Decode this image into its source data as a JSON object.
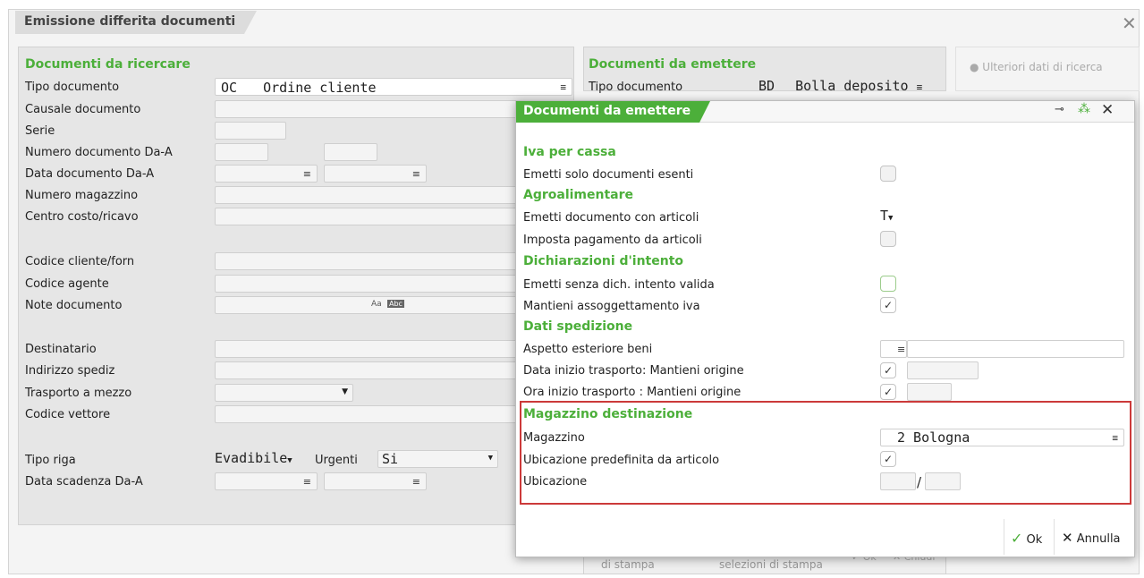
{
  "window": {
    "title": "Emissione differita documenti",
    "close_icon": "close-icon"
  },
  "left": {
    "section_title": "Documenti da ricercare",
    "tipo_documento": {
      "label": "Tipo documento",
      "code": "OC",
      "value": "Ordine cliente"
    },
    "causale": "Causale documento",
    "serie": "Serie",
    "numero_da_a": "Numero documento Da-A",
    "data_da_a": "Data documento Da-A",
    "numero_magazzino": "Numero magazzino",
    "centro_costo": "Centro costo/ricavo",
    "codice_cliente": "Codice cliente/forn",
    "codice_agente": "Codice agente",
    "note_documento": "Note documento",
    "destinatario": "Destinatario",
    "indirizzo_spediz": "Indirizzo spediz",
    "trasporto": "Trasporto a mezzo",
    "codice_vettore": "Codice vettore",
    "tipo_riga": {
      "label": "Tipo riga",
      "value": "Evadibile",
      "urgenti_label": "Urgenti",
      "urgenti_value": "Si"
    },
    "data_scadenza": "Data scadenza Da-A"
  },
  "right": {
    "section_title": "Documenti da emettere",
    "tipo_documento": {
      "label": "Tipo documento",
      "code": "BD",
      "value": "Bolla deposito"
    },
    "ulteriori": "Ulteriori dati di ricerca",
    "bottom_buttons": [
      "di stampa",
      "selezioni di stampa",
      "Ok",
      "Chiudi"
    ]
  },
  "dialog": {
    "title": "Documenti da emettere",
    "sections": {
      "iva": "Iva per cassa",
      "agro": "Agroalimentare",
      "dich": "Dichiarazioni d'intento",
      "sped": "Dati spedizione",
      "mag": "Magazzino destinazione"
    },
    "rows": {
      "emetti_esenti": "Emetti solo documenti esenti",
      "emetti_articoli": "Emetti documento con articoli",
      "emetti_articoli_value": "T",
      "imposta_pagamento": "Imposta pagamento da articoli",
      "emetti_senza_dich": "Emetti senza dich. intento valida",
      "mantieni_iva": "Mantieni assoggettamento iva",
      "aspetto": "Aspetto esteriore beni",
      "data_inizio": "Data inizio trasporto: Mantieni origine",
      "ora_inizio": "Ora inizio trasporto : Mantieni origine",
      "magazzino": "Magazzino",
      "magazzino_value": "2 Bologna",
      "ubicazione_predef": "Ubicazione predefinita da articolo",
      "ubicazione": "Ubicazione"
    },
    "ok_label": "Ok",
    "annulla_label": "Annulla",
    "checkmark": "✓"
  }
}
